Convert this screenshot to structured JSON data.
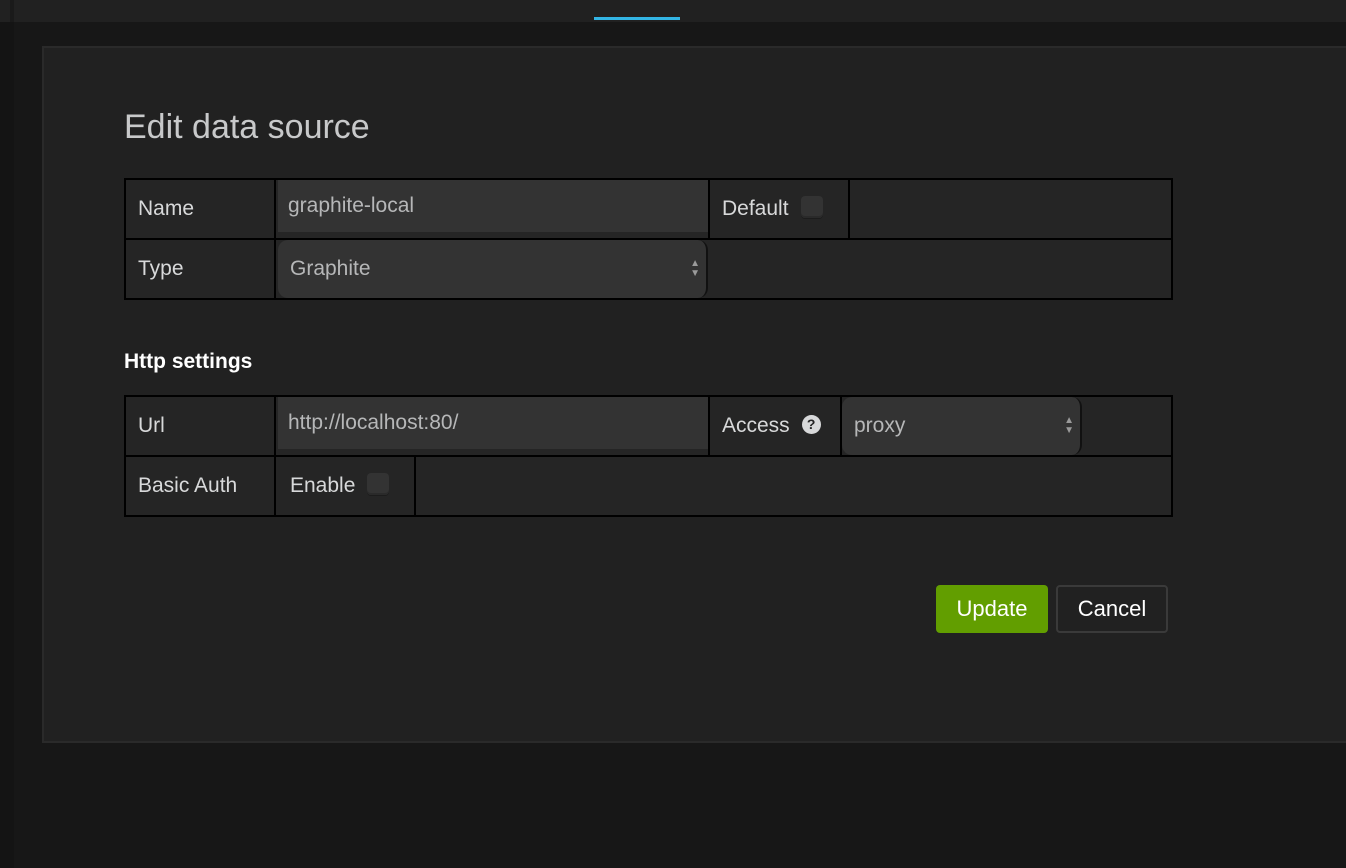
{
  "topbar": {
    "accent_color": "#33b5e5"
  },
  "page": {
    "title": "Edit data source"
  },
  "general": {
    "name_label": "Name",
    "name_value": "graphite-local",
    "default_label": "Default",
    "default_checked": false,
    "type_label": "Type",
    "type_value": "Graphite"
  },
  "http": {
    "section_title": "Http settings",
    "url_label": "Url",
    "url_value": "http://localhost:80/",
    "access_label": "Access",
    "access_help_icon": "question-circle-icon",
    "access_value": "proxy",
    "basic_auth_label": "Basic Auth",
    "enable_label": "Enable",
    "enable_checked": false
  },
  "actions": {
    "update_label": "Update",
    "cancel_label": "Cancel",
    "update_color": "#629e00"
  }
}
